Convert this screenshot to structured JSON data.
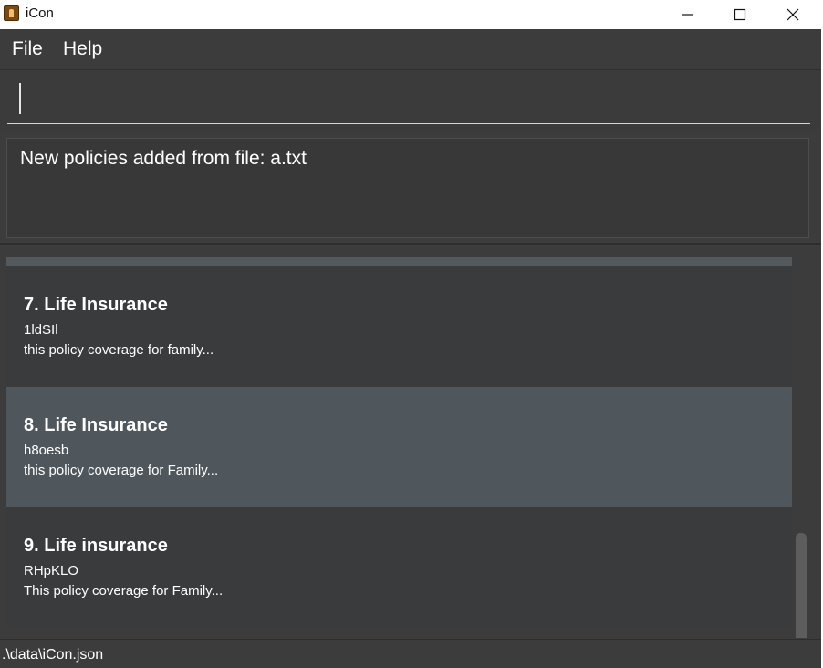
{
  "window": {
    "title": "iCon",
    "controls": {
      "minimize": "minimize-icon",
      "maximize": "maximize-icon",
      "close": "close-icon"
    }
  },
  "menu": {
    "file_label": "File",
    "help_label": "Help"
  },
  "command": {
    "value": "",
    "placeholder": ""
  },
  "result": {
    "message": "New policies added from file: a.txt"
  },
  "policies": [
    {
      "title": "7. Life Insurance",
      "code": "1ldSIl",
      "description": "this policy coverage for family..."
    },
    {
      "title": "8. Life Insurance",
      "code": "h8oesb",
      "description": "this policy coverage for Family...",
      "selected": true
    },
    {
      "title": "9. Life insurance",
      "code": "RHpKLO",
      "description": "This policy coverage for Family..."
    }
  ],
  "status": {
    "path": ".\\data\\iCon.json"
  },
  "colors": {
    "background": "#3c3c3c",
    "selected_card": "#50575c",
    "card": "#3a3b3d",
    "text": "#ffffff"
  }
}
